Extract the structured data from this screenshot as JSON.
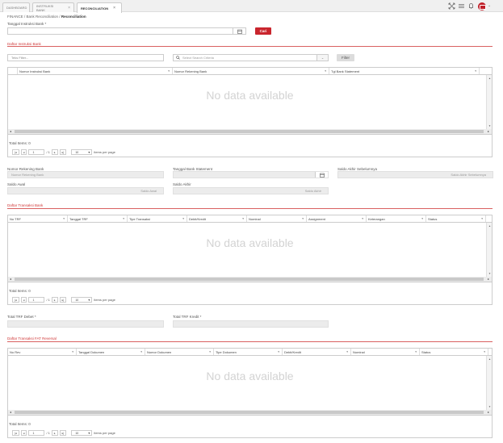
{
  "tabs": [
    {
      "label": "DASHBOARD"
    },
    {
      "label": "INSTRUKSI BANK"
    },
    {
      "label": "RECONCILIATION"
    }
  ],
  "breadcrumb": {
    "root": "FINANCE",
    "parent": "Bank Reconciliation",
    "current": "Reconciliation"
  },
  "search": {
    "label": "Tanggal Instruksi Bank *",
    "search_button": "Cari"
  },
  "instruksi_section": {
    "title": "Daftar Instruksi Bank",
    "filter_placeholder": "Teks Filter...",
    "criteria_placeholder": "Select Search Criteria",
    "filter_button": "Filter",
    "columns": [
      "Nomor Instruksi Bank",
      "Nomor Rekening Bank",
      "Tgl Bank Statement"
    ],
    "no_data": "No data available",
    "total_items": "Total Items: 0",
    "pager": {
      "page": "1",
      "of": "/ 1",
      "per_page": "10",
      "per_page_label": "items per page"
    }
  },
  "statement_form": {
    "nomor_rekening_label": "Nomor Rekening Bank",
    "nomor_rekening_value": "Nomor Rekening Bank",
    "tanggal_statement_label": "Tanggal Bank Statement",
    "saldo_akhir_sebelum_label": "Saldo Akhir Sebelumnya",
    "saldo_akhir_sebelum_value": "Saldo Akhir Sebelumnya",
    "saldo_awal_label": "Saldo Awal",
    "saldo_awal_value": "Saldo Awal",
    "saldo_akhir_label": "Saldo Akhir",
    "saldo_akhir_value": "Saldo Akhir"
  },
  "transaksi_section": {
    "title": "Daftar Transaksi Bank",
    "columns": [
      "No TRF",
      "Tanggal TRF",
      "Tipe Transaksi",
      "Debit/Kredit",
      "Nominal",
      "Assignment",
      "Keterangan",
      "Status"
    ],
    "no_data": "No data available",
    "total_items": "Total Items: 0",
    "pager": {
      "page": "1",
      "of": "/ 1",
      "per_page": "10",
      "per_page_label": "items per page"
    }
  },
  "totals": {
    "debet_label": "Total TRF Debet *",
    "kredit_label": "Total TRF Kredit *"
  },
  "reversal_section": {
    "title": "Daftar Transaksi FAT Reversal",
    "columns": [
      "No Rev",
      "Tanggal Dokumen",
      "Nomor Dokumen",
      "Tipe Dokumen",
      "Debit/Kredit",
      "Nominal",
      "Status"
    ],
    "no_data": "No data available",
    "total_items": "Total Items: 0",
    "pager": {
      "page": "1",
      "of": "/ 1",
      "per_page": "10",
      "per_page_label": "items per page"
    }
  },
  "icons": {
    "expand": "expand-icon",
    "menu": "menu-icon",
    "bell": "bell-icon",
    "user": "user-avatar",
    "calendar": "calendar-icon",
    "search": "search-icon"
  },
  "colors": {
    "accent": "#c9252d",
    "section_title": "#d03a3a"
  }
}
